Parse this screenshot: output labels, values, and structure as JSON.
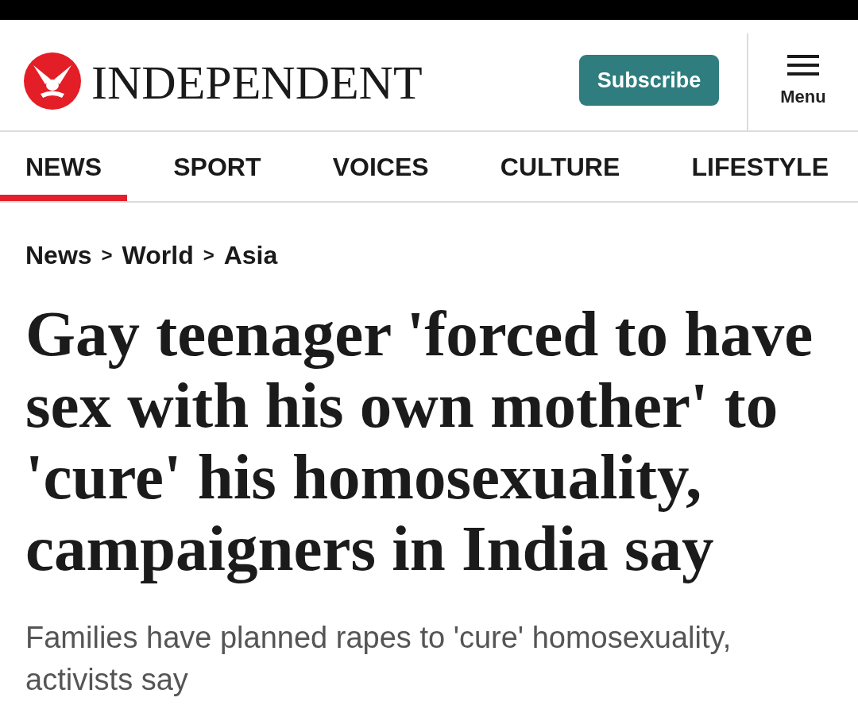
{
  "header": {
    "logo_text": "INDEPENDENT",
    "subscribe_button": "Subscribe",
    "menu_button": "Menu"
  },
  "nav": {
    "tabs": [
      {
        "label": "NEWS",
        "selected": true
      },
      {
        "label": "SPORT",
        "selected": false
      },
      {
        "label": "VOICES",
        "selected": false
      },
      {
        "label": "CULTURE",
        "selected": false
      },
      {
        "label": "LIFESTYLE",
        "selected": false
      }
    ]
  },
  "breadcrumb": [
    {
      "kind": "link",
      "text": "News"
    },
    {
      "kind": "separator",
      "text": ">"
    },
    {
      "kind": "link",
      "text": "World"
    },
    {
      "kind": "separator",
      "text": ">"
    },
    {
      "kind": "link",
      "text": "Asia"
    }
  ],
  "article": {
    "headline": "Gay teenager 'forced to have sex with his own mother' to 'cure' his homosexuality, campaigners in India say",
    "standfirst": "Families have planned rapes to 'cure' homosexuality, activists say"
  }
}
